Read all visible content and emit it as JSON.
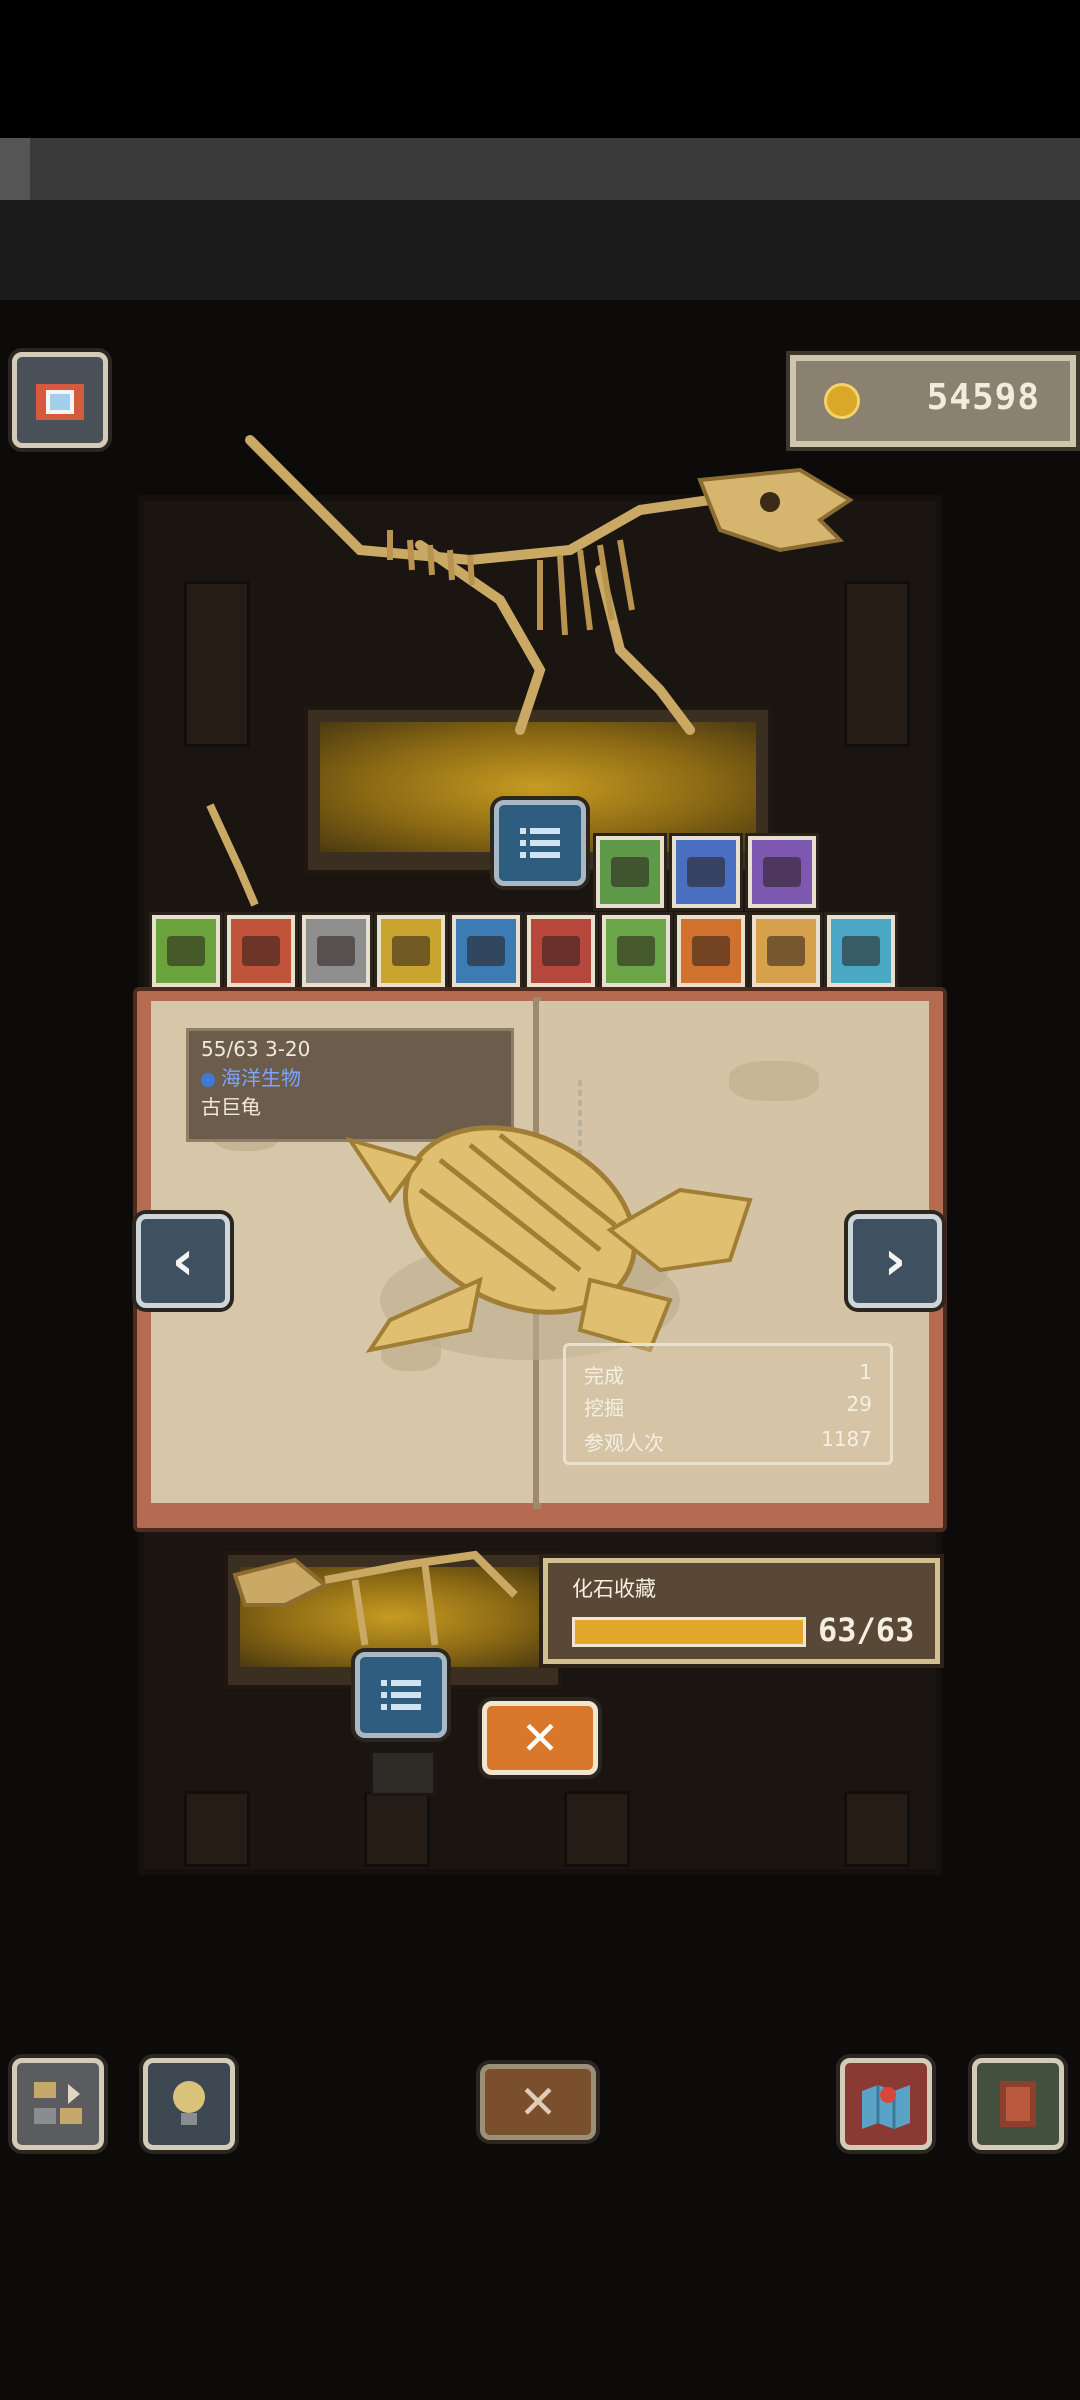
{
  "currency": {
    "coins": "54598"
  },
  "tabs": {
    "upper": [
      {
        "name": "tab-long-neck-dino",
        "color": "#5e9a4a"
      },
      {
        "name": "tab-plesiosaur",
        "color": "#4a6fc2"
      },
      {
        "name": "tab-ammonite",
        "color": "#7c58b0"
      }
    ],
    "lower": [
      {
        "name": "tab-barrel",
        "color": "#6aa33c"
      },
      {
        "name": "tab-chest",
        "color": "#c0533a"
      },
      {
        "name": "tab-grey-case",
        "color": "#8e8e8e"
      },
      {
        "name": "tab-gold-case",
        "color": "#c9a42f"
      },
      {
        "name": "tab-blue-case",
        "color": "#3d7bb5"
      },
      {
        "name": "tab-trex",
        "color": "#b7473a"
      },
      {
        "name": "tab-raptor",
        "color": "#6aa548"
      },
      {
        "name": "tab-stegosaur",
        "color": "#d0722d"
      },
      {
        "name": "tab-triceratops",
        "color": "#d7a04a"
      },
      {
        "name": "tab-pterosaur",
        "color": "#4aa8c4"
      }
    ]
  },
  "fossil": {
    "progress": "55/63 3-20",
    "category": "海洋生物",
    "name": "古巨龟"
  },
  "stats": {
    "complete_label": "完成",
    "complete_value": "1",
    "dig_label": "挖掘",
    "dig_value": "29",
    "visitors_label": "参观人次",
    "visitors_value": "1187"
  },
  "collection": {
    "label": "化石收藏",
    "count": "63/63",
    "progress": 1.0
  },
  "nav": {
    "prev": "‹",
    "next": "›"
  },
  "close": "✕"
}
